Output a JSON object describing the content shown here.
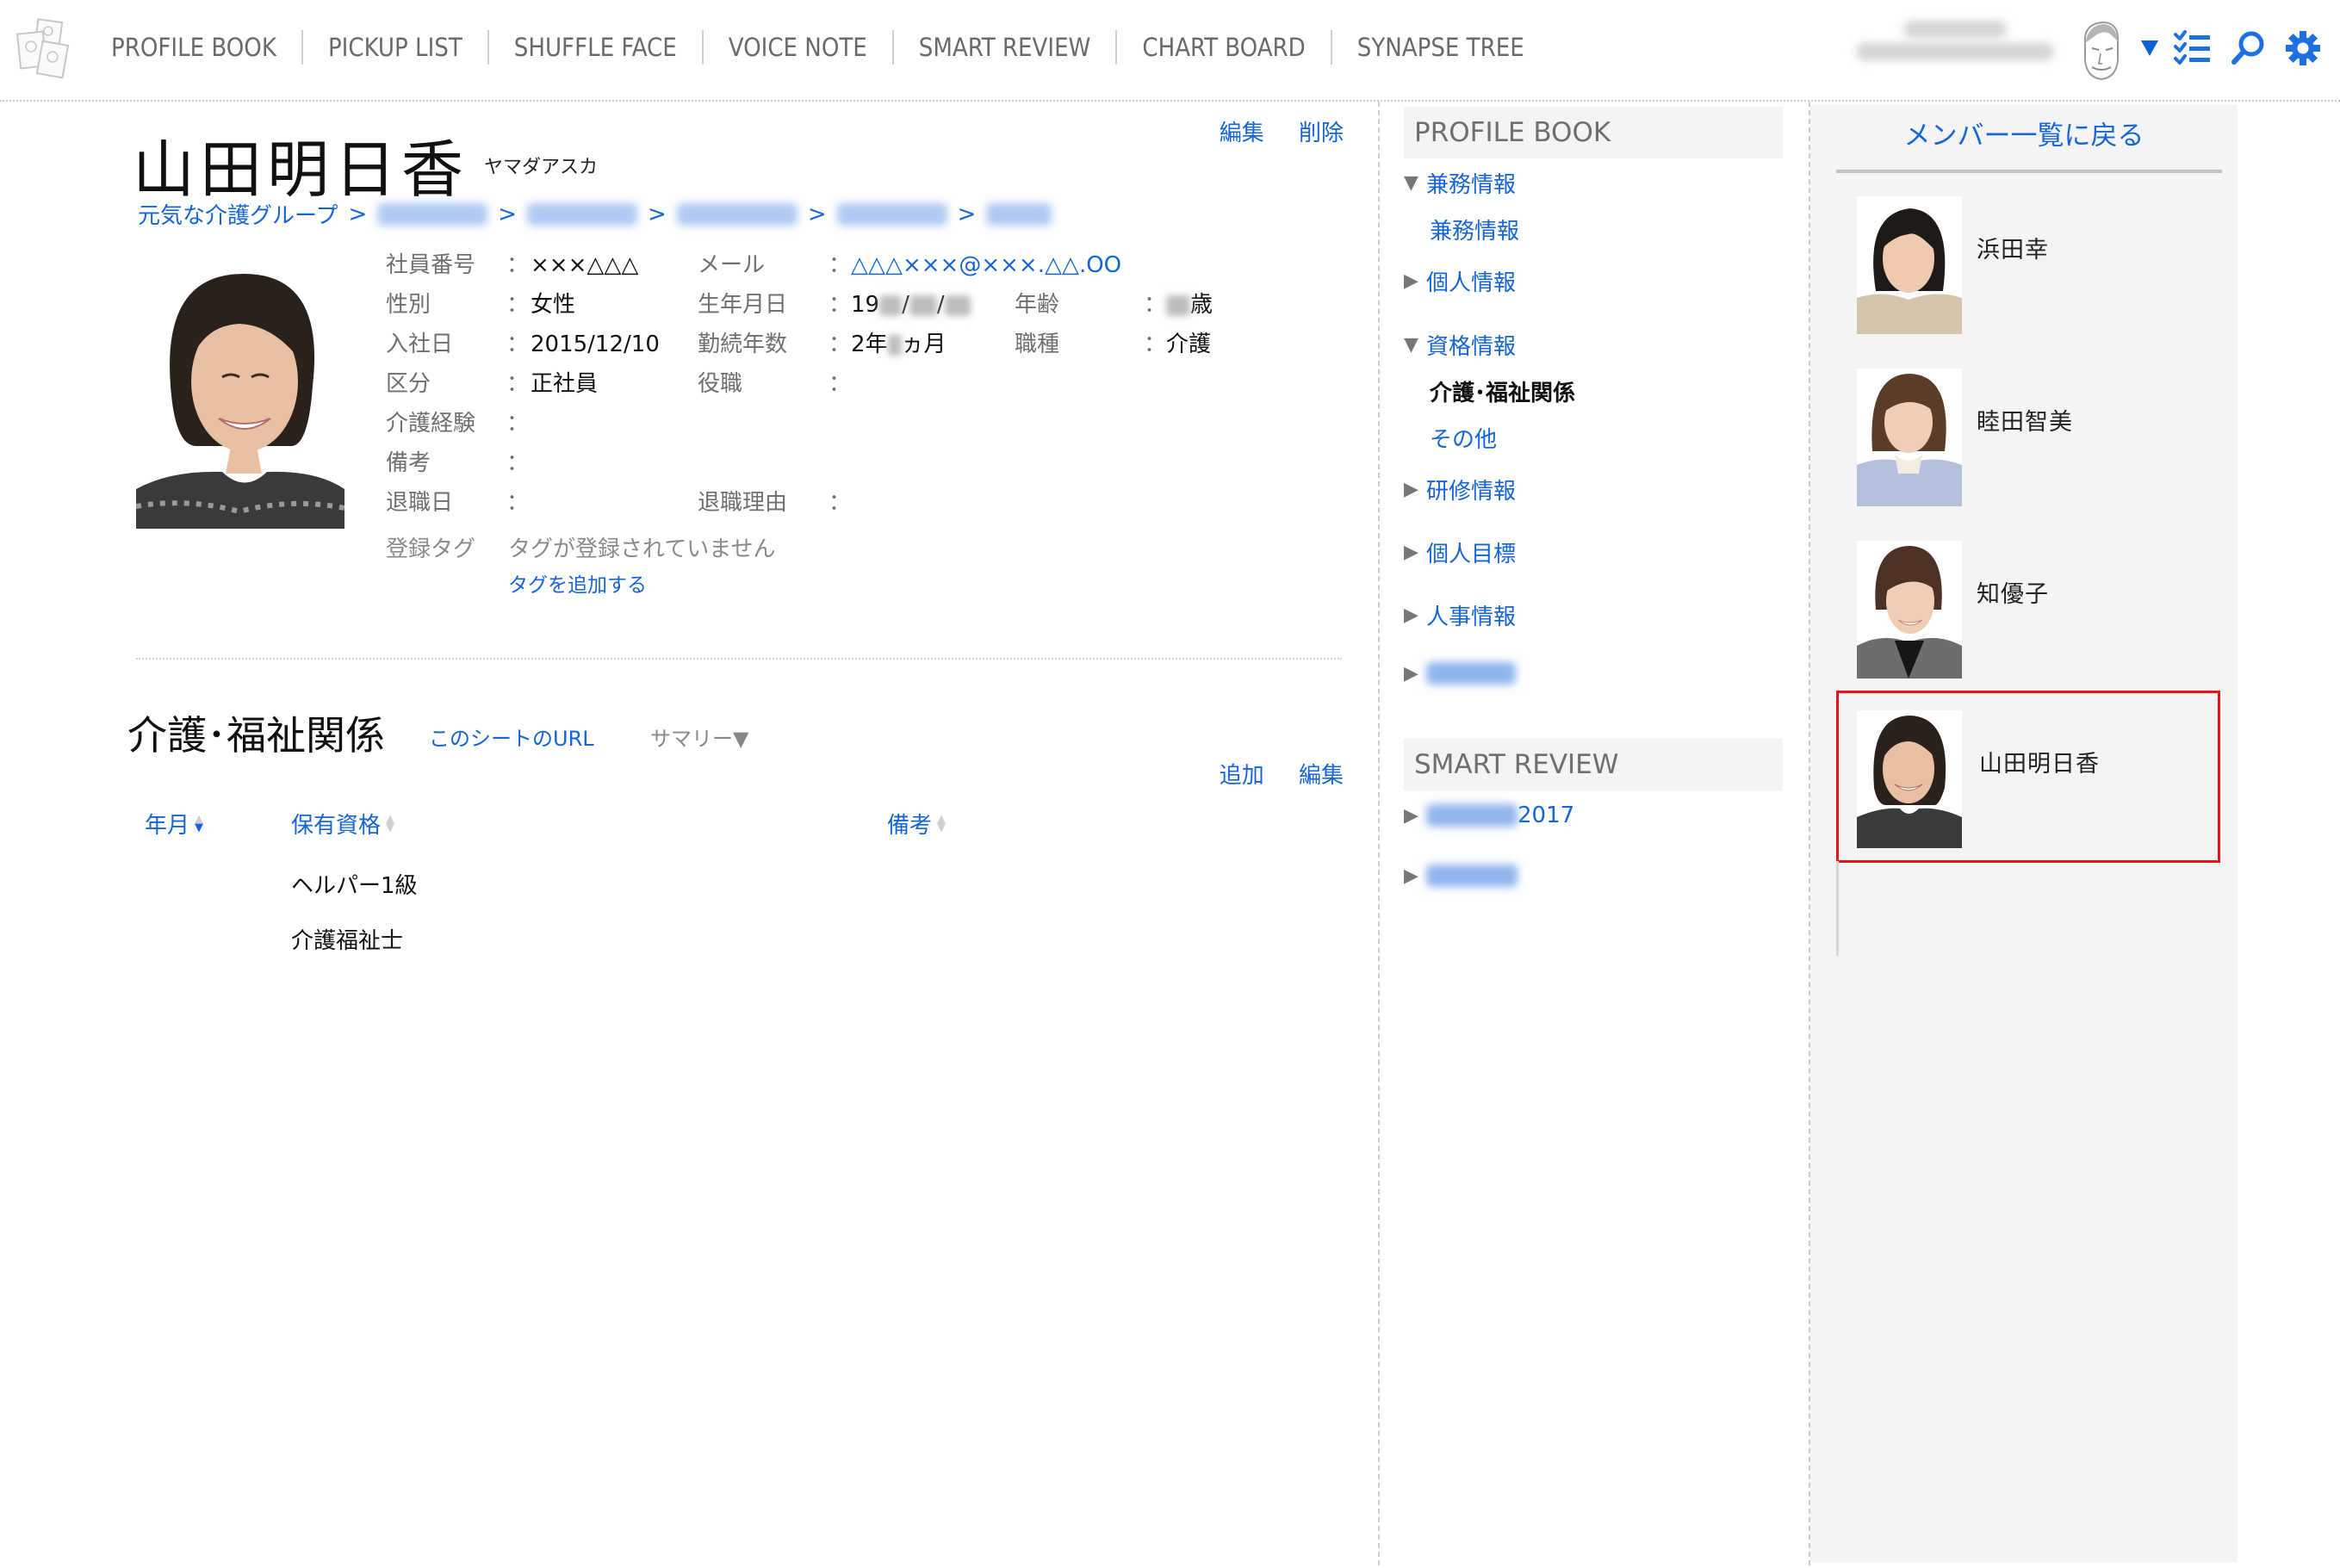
{
  "header": {
    "nav": [
      "PROFILE BOOK",
      "PICKUP LIST",
      "SHUFFLE FACE",
      "VOICE NOTE",
      "SMART REVIEW",
      "CHART BOARD",
      "SYNAPSE TREE"
    ],
    "icons": {
      "logo": "profile-book-logo",
      "user_menu": "dropdown-triangle",
      "checklist": "checklist-icon",
      "search": "search-icon",
      "settings": "gear-icon"
    },
    "accent_color": "#1565d8"
  },
  "profile": {
    "name": "山田明日香",
    "kana": "ヤマダアスカ",
    "actions": {
      "edit": "編集",
      "delete": "削除"
    },
    "breadcrumb_root": "元気な介護グループ",
    "breadcrumb_sep": ">",
    "fields": {
      "employee_no": {
        "label": "社員番号",
        "value": "×××△△△"
      },
      "email": {
        "label": "メール",
        "value": "△△△×××@×××.△△.OO"
      },
      "gender": {
        "label": "性別",
        "value": "女性"
      },
      "birthday": {
        "label": "生年月日",
        "value_prefix": "19",
        "slash": "/"
      },
      "age": {
        "label": "年齢",
        "value_suffix": "歳"
      },
      "join_date": {
        "label": "入社日",
        "value": "2015/12/10"
      },
      "tenure": {
        "label": "勤続年数",
        "value_prefix": "2年",
        "value_suffix": "ヵ月"
      },
      "job_type": {
        "label": "職種",
        "value": "介護"
      },
      "category": {
        "label": "区分",
        "value": "正社員"
      },
      "position": {
        "label": "役職",
        "value": ""
      },
      "care_experience": {
        "label": "介護経験",
        "value": ""
      },
      "notes": {
        "label": "備考",
        "value": ""
      },
      "retire_date": {
        "label": "退職日",
        "value": ""
      },
      "retire_reason": {
        "label": "退職理由",
        "value": ""
      }
    },
    "colon": "：",
    "tags": {
      "label": "登録タグ",
      "empty": "タグが登録されていません",
      "add": "タグを追加する"
    }
  },
  "section": {
    "title": "介護･福祉関係",
    "sheet_url": "このシートのURL",
    "summary": "サマリー▼",
    "actions": {
      "add": "追加",
      "edit": "編集"
    },
    "columns": [
      "年月",
      "保有資格",
      "備考"
    ],
    "rows": [
      {
        "date": "",
        "qualification": "ヘルパー1級",
        "note": ""
      },
      {
        "date": "",
        "qualification": "介護福祉士",
        "note": ""
      }
    ]
  },
  "sidebar": {
    "profile_book_heading": "PROFILE BOOK",
    "items": [
      {
        "label": "兼務情報",
        "expanded": true
      },
      {
        "label": "兼務情報",
        "sub": true
      },
      {
        "label": "個人情報",
        "expanded": false
      },
      {
        "label": "資格情報",
        "expanded": true
      },
      {
        "label": "介護･福祉関係",
        "sub": true,
        "active": true
      },
      {
        "label": "その他",
        "sub": true
      },
      {
        "label": "研修情報",
        "expanded": false
      },
      {
        "label": "個人目標",
        "expanded": false
      },
      {
        "label": "人事情報",
        "expanded": false
      },
      {
        "label": "",
        "expanded": false,
        "blurred": true
      }
    ],
    "smart_review_heading": "SMART REVIEW",
    "review_items": [
      {
        "label_suffix": "2017",
        "blurred_prefix": true
      },
      {
        "label_suffix": "",
        "blurred_prefix": true
      }
    ]
  },
  "members": {
    "back_link": "メンバー一覧に戻る",
    "list": [
      {
        "name": "浜田幸",
        "current": false
      },
      {
        "name": "睦田智美",
        "current": false
      },
      {
        "name": "知優子",
        "current": false
      },
      {
        "name": "山田明日香",
        "current": true
      }
    ],
    "highlight_color": "#e8121b"
  }
}
